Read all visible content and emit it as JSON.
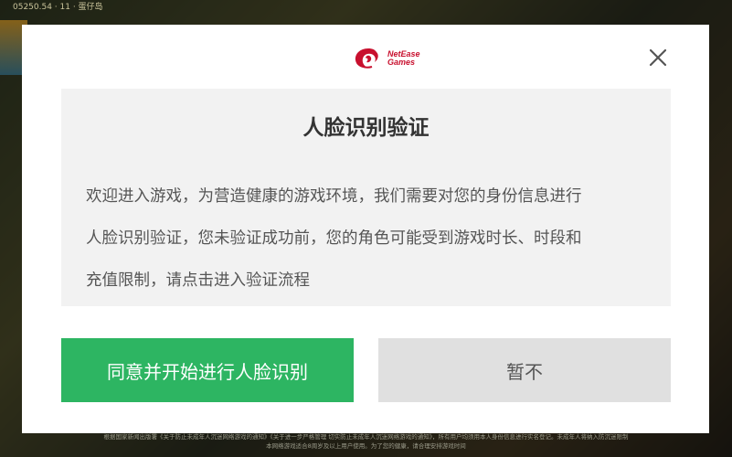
{
  "background": {
    "topbar_text": "05250.54 · 11 · 蛋仔岛",
    "footer_line1": "根据国家新闻出版署《关于防止未成年人沉迷网络游戏的通知》《关于进一步严格管理 切实防止未成年人沉迷网络游戏的通知》，所有用户均须用本人身份信息进行实名登记。未成年人将纳入防沉迷限制",
    "footer_line2": "本网络游戏适合8周岁及以上用户使用。为了您的健康，请合理安排游戏时间"
  },
  "logo": {
    "text_line1": "NetEase",
    "text_line2": "Games"
  },
  "dialog": {
    "title": "人脸识别验证",
    "body_lines": [
      "欢迎进入游戏，为营造健康的游戏环境，我们需要对您的身份信息进行",
      "人脸识别验证，您未验证成功前，您的角色可能受到游戏时长、时段和",
      "充值限制，请点击进入验证流程"
    ],
    "agree_button": "同意并开始进行人脸识别",
    "later_button": "暂不"
  },
  "colors": {
    "primary": "#2db562",
    "secondary_button": "#e0e0e0",
    "content_bg": "#f2f2f2",
    "brand": "#c8102e"
  },
  "icons": {
    "close": "close-icon",
    "logo": "netease-logo-icon"
  }
}
